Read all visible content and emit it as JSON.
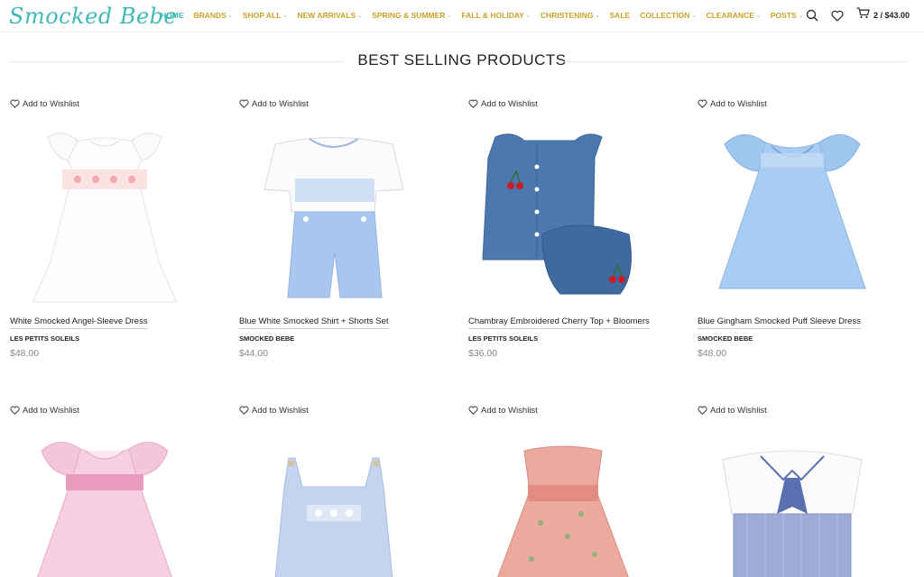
{
  "brand": {
    "logo_text": "Smocked Bebe"
  },
  "nav": {
    "items": [
      {
        "label": "HOME",
        "dropdown": false
      },
      {
        "label": "BRANDS",
        "dropdown": true
      },
      {
        "label": "SHOP ALL",
        "dropdown": true
      },
      {
        "label": "NEW ARRIVALS",
        "dropdown": true
      },
      {
        "label": "SPRING & SUMMER",
        "dropdown": true
      },
      {
        "label": "FALL & HOLIDAY",
        "dropdown": true
      },
      {
        "label": "CHRISTENING",
        "dropdown": true
      },
      {
        "label": "SALE",
        "dropdown": false
      },
      {
        "label": "COLLECTION",
        "dropdown": true
      },
      {
        "label": "CLEARANCE",
        "dropdown": true
      },
      {
        "label": "POSTS",
        "dropdown": true
      }
    ],
    "chevron": "⌄",
    "accent_color": "#3fb9b3",
    "nav_color": "#c9a227"
  },
  "header": {
    "icons": [
      "search-icon",
      "heart-icon",
      "cart-icon"
    ],
    "cart_summary": "2 / $43.00"
  },
  "section": {
    "title": "BEST SELLING PRODUCTS"
  },
  "products": [
    {
      "wishlist": "Add to Wishlist",
      "name": "White Smocked Angel-Sleeve Dress",
      "brand": "LES PETITS SOLEILS",
      "price": "$48.00"
    },
    {
      "wishlist": "Add to Wishlist",
      "name": "Blue White Smocked Shirt + Shorts Set",
      "brand": "SMOCKED BEBE",
      "price": "$44.00"
    },
    {
      "wishlist": "Add to Wishlist",
      "name": "Chambray Embroidered Cherry Top + Bloomers",
      "brand": "LES PETITS SOLEILS",
      "price": "$36.00"
    },
    {
      "wishlist": "Add to Wishlist",
      "name": "Blue Gingham Smocked Puff Sleeve Dress",
      "brand": "SMOCKED BEBE",
      "price": "$48.00"
    },
    {
      "wishlist": "Add to Wishlist",
      "name": "",
      "brand": "",
      "price": ""
    },
    {
      "wishlist": "Add to Wishlist",
      "name": "",
      "brand": "",
      "price": ""
    },
    {
      "wishlist": "Add to Wishlist",
      "name": "",
      "brand": "",
      "price": ""
    },
    {
      "wishlist": "Add to Wishlist",
      "name": "",
      "brand": "",
      "price": ""
    }
  ]
}
